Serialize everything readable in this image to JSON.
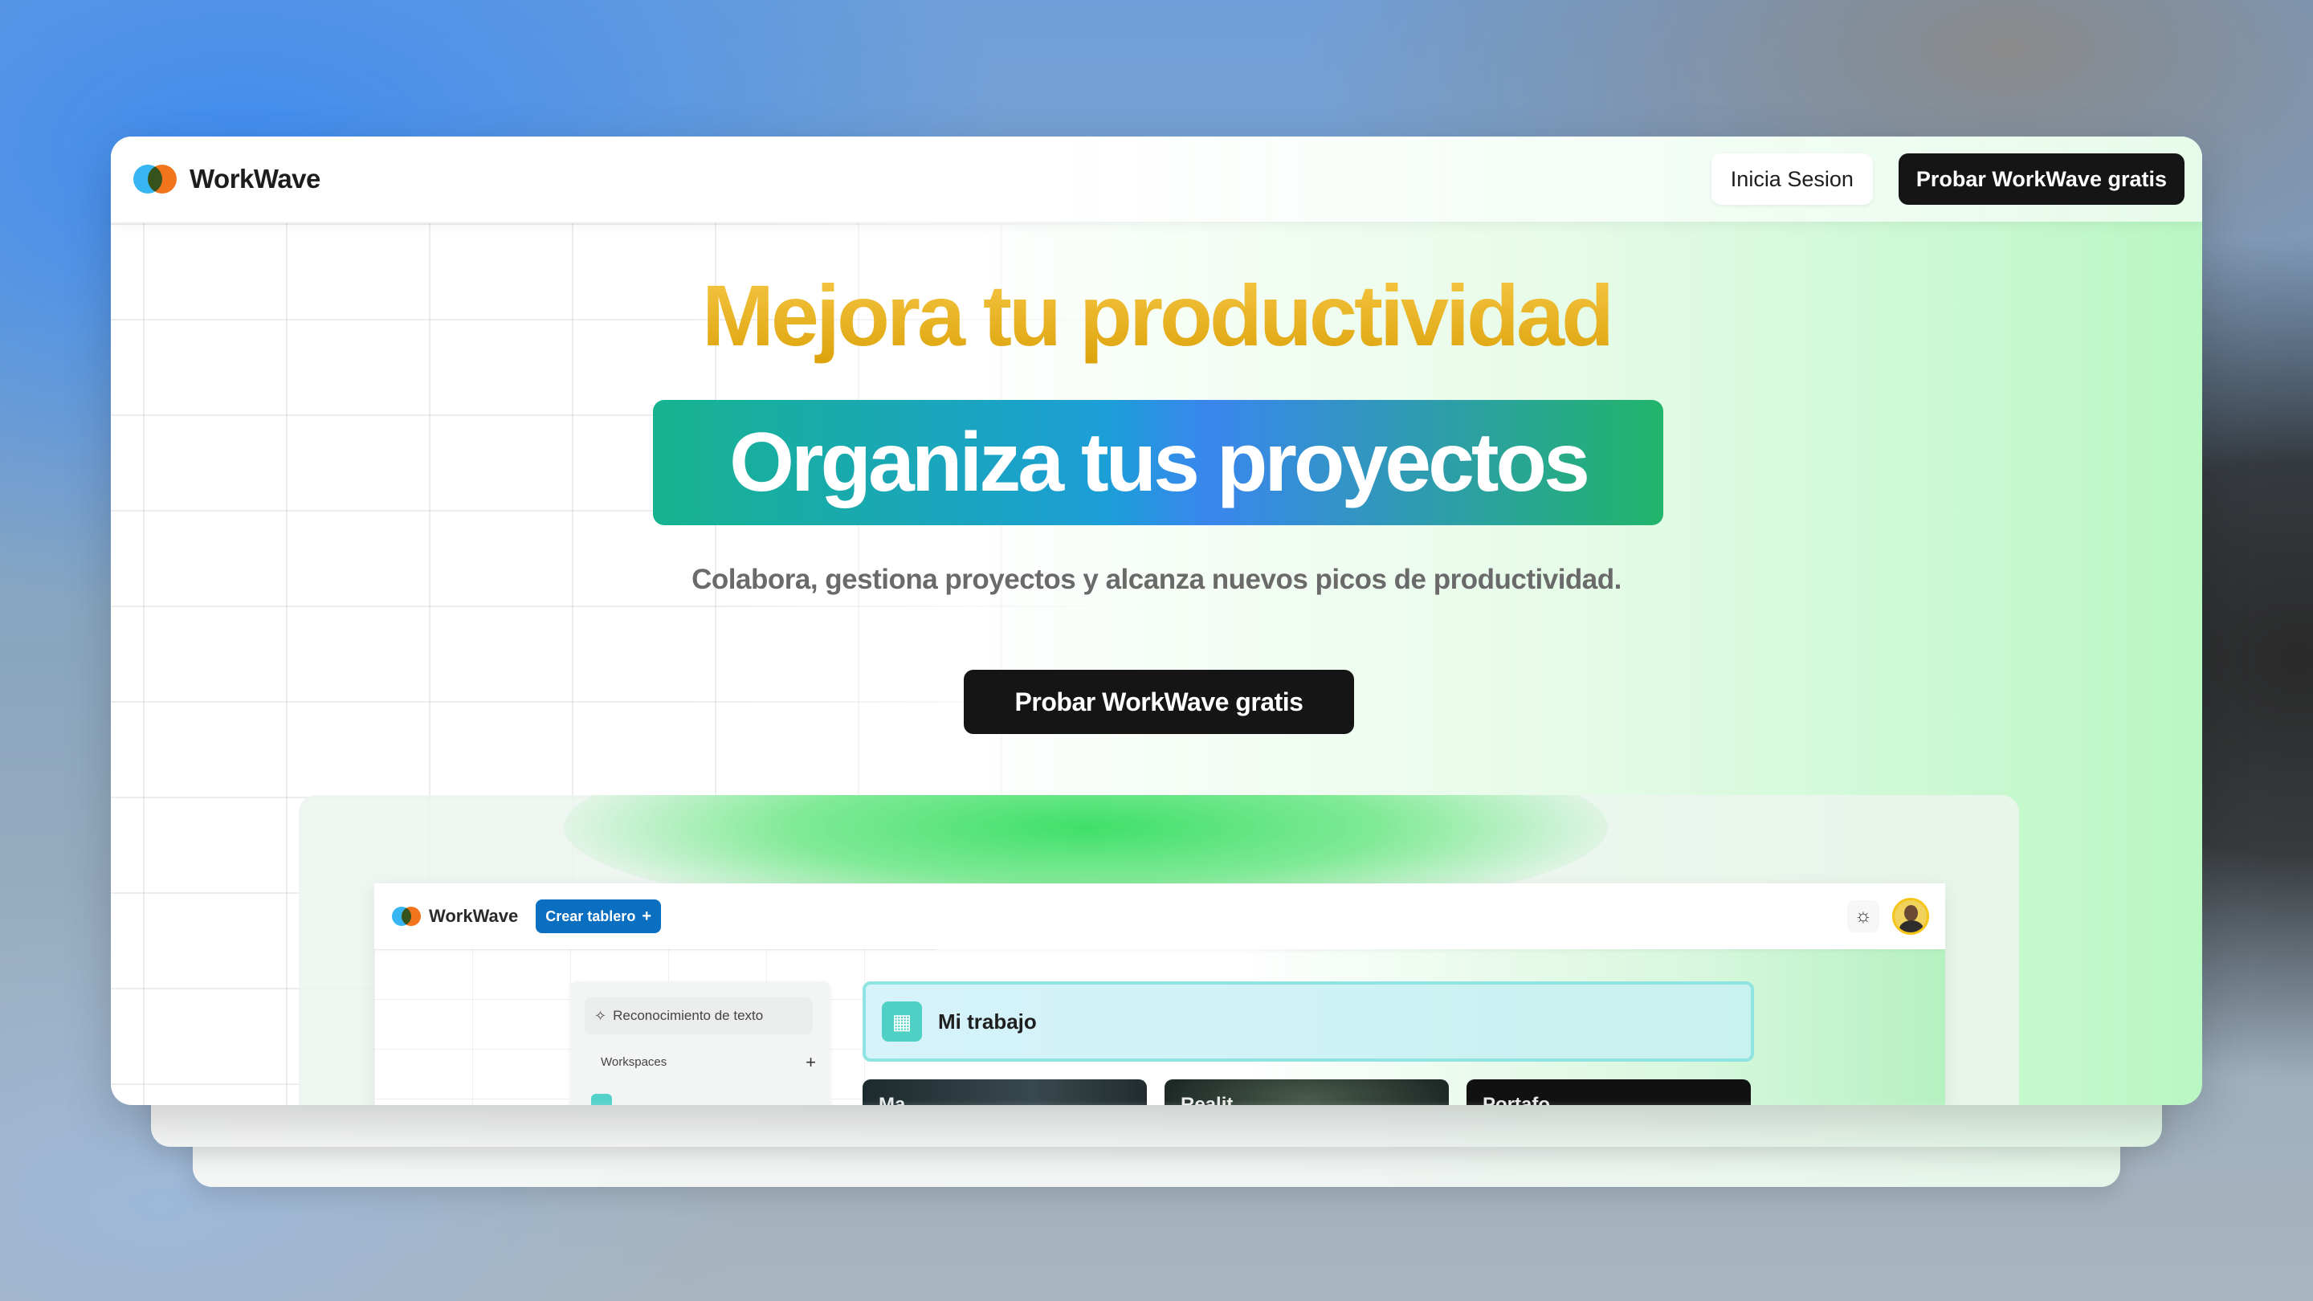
{
  "brand": {
    "name": "WorkWave",
    "colors": {
      "logo_blue": "#38b6f4",
      "logo_orange": "#f2741c"
    }
  },
  "nav": {
    "login_label": "Inicia Sesion",
    "try_label": "Probar WorkWave gratis"
  },
  "hero": {
    "title": "Mejora tu productividad",
    "band_text": "Organiza tus proyectos",
    "subtitle": "Colabora, gestiona proyectos y alcanza nuevos picos de productividad.",
    "cta_label": "Probar WorkWave gratis",
    "colors": {
      "title_gold": "#e0a810",
      "band_start": "#17b38f",
      "band_mid": "#3a86ee",
      "band_end": "#21b46a",
      "cta_bg": "#151515"
    }
  },
  "preview": {
    "app_name": "WorkWave",
    "create_board_label": "Crear tablero",
    "create_board_icon": "plus-icon",
    "theme_icon": "sun-icon",
    "avatar_icon": "user-avatar",
    "sidebar": {
      "search_item": "Reconocimiento de texto",
      "search_icon": "sparkle-icon",
      "workspaces_label": "Workspaces",
      "workspaces_add_icon": "plus-icon"
    },
    "my_work": {
      "label": "Mi trabajo",
      "icon": "building-icon"
    },
    "boards": [
      {
        "label": "Ma"
      },
      {
        "label": "Realit"
      },
      {
        "label": "Portafo"
      }
    ],
    "colors": {
      "create_board_bg": "#0b6fc1",
      "my_work_border": "#8fe3e0",
      "my_work_icon_bg": "#4fd0c4"
    }
  }
}
